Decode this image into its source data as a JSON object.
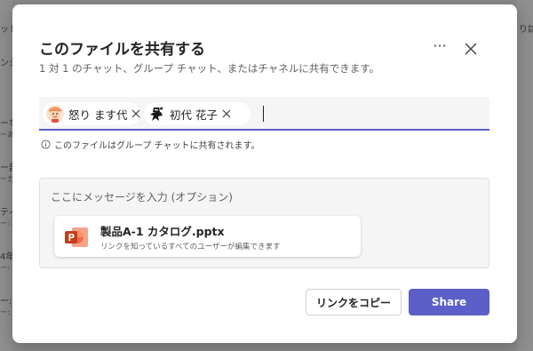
{
  "background": {
    "left_fragments": [
      "ット",
      "ンジ",
      "ーな",
      "ーあ",
      "ー部",
      "ーカ",
      "ティ",
      "ー: 秘",
      "4年",
      "ー: 7",
      "ー: て",
      "ー: 1"
    ],
    "right_fragment": "り訪"
  },
  "dialog": {
    "title": "このファイルを共有する",
    "subtitle": "1 対 1 のチャット、グループ チャット、またはチャネルに共有できます。",
    "more_label": "···",
    "recipients": [
      {
        "name": "怒り ます代",
        "avatar": "person-avatar-icon"
      },
      {
        "name": "初代 花子",
        "avatar": "ninja-avatar-icon"
      }
    ],
    "info_text": "このファイルはグループ チャットに共有されます。",
    "message_placeholder": "ここにメッセージを入力 (オプション)",
    "file": {
      "name": "製品A-1 カタログ.pptx",
      "permission": "リンクを知っているすべてのユーザーが編集できます",
      "icon": "powerpoint-icon"
    },
    "buttons": {
      "copy_link": "リンクをコピー",
      "share": "Share"
    }
  },
  "colors": {
    "accent": "#5b5fc7",
    "powerpoint": "#c43e1c"
  }
}
